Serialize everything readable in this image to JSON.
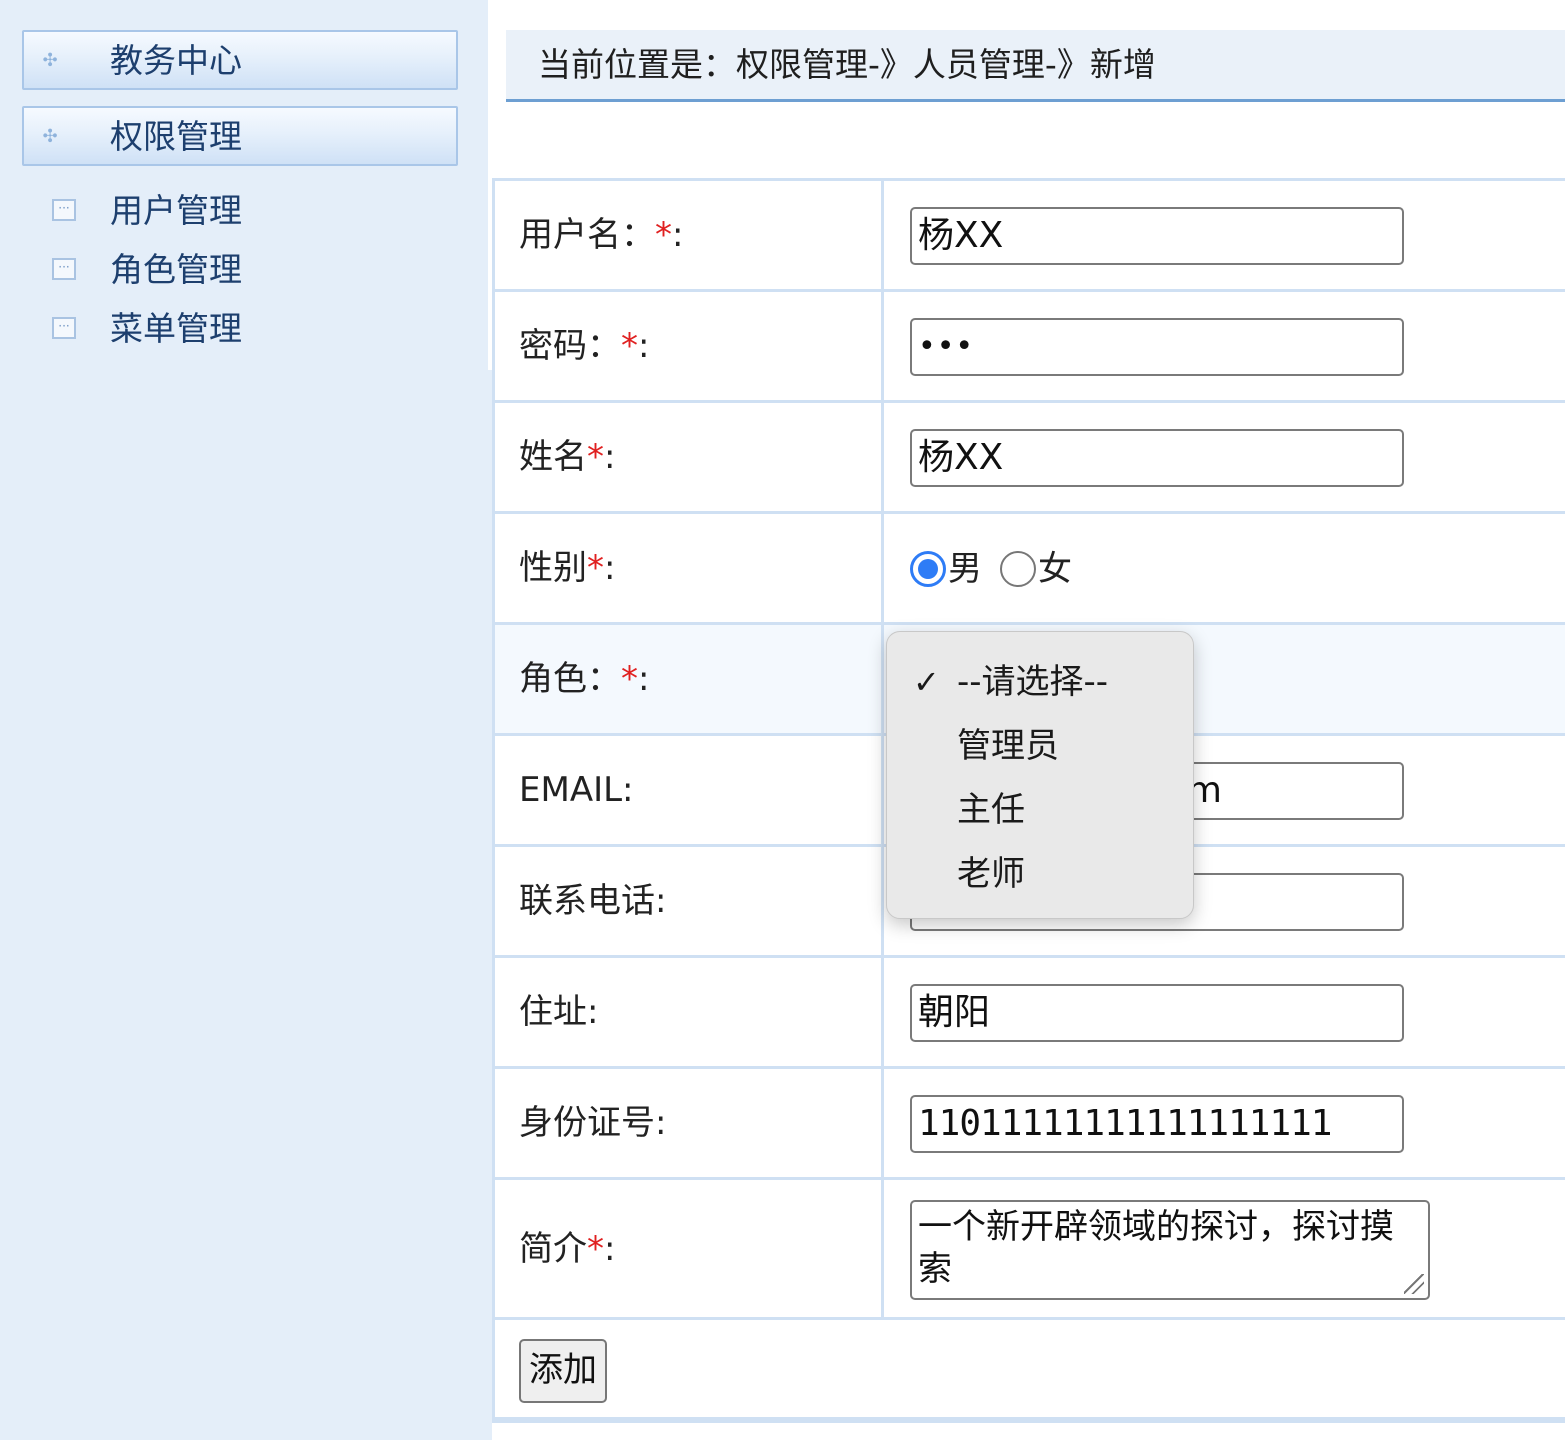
{
  "sidebar": {
    "groups": [
      {
        "label": "教务中心"
      },
      {
        "label": "权限管理"
      }
    ],
    "items": [
      {
        "label": "用户管理"
      },
      {
        "label": "角色管理"
      },
      {
        "label": "菜单管理"
      }
    ]
  },
  "breadcrumb": {
    "text": "当前位置是：权限管理-》人员管理-》新增"
  },
  "form": {
    "username": {
      "label": "用户名：",
      "req": "*",
      "suffix": ":",
      "value": "杨XX"
    },
    "password": {
      "label": "密码：",
      "req": "*",
      "suffix": ":",
      "value": "•••"
    },
    "name": {
      "label": "姓名",
      "req": "*",
      "suffix": ":",
      "value": "杨XX"
    },
    "gender": {
      "label": "性别",
      "req": "*",
      "suffix": ":",
      "options": [
        "男",
        "女"
      ],
      "selected": "男"
    },
    "role": {
      "label": "角色：",
      "req": "*",
      "suffix": ":",
      "selected": "--请选择--"
    },
    "email": {
      "label": "EMAIL:",
      "value_visible": "m"
    },
    "phone": {
      "label": "联系电话:",
      "value_visible": ""
    },
    "address": {
      "label": "住址:",
      "value": "朝阳"
    },
    "idcard": {
      "label": "身份证号:",
      "value": "11011111111111111111"
    },
    "intro": {
      "label": "简介",
      "req": "*",
      "suffix": ":",
      "value": "一个新开辟领域的探讨，探讨摸索"
    },
    "submit_label": "添加"
  },
  "role_dropdown": {
    "check_glyph": "✓",
    "options": [
      "--请选择--",
      "管理员",
      "主任",
      "老师"
    ],
    "selected_index": 0
  }
}
